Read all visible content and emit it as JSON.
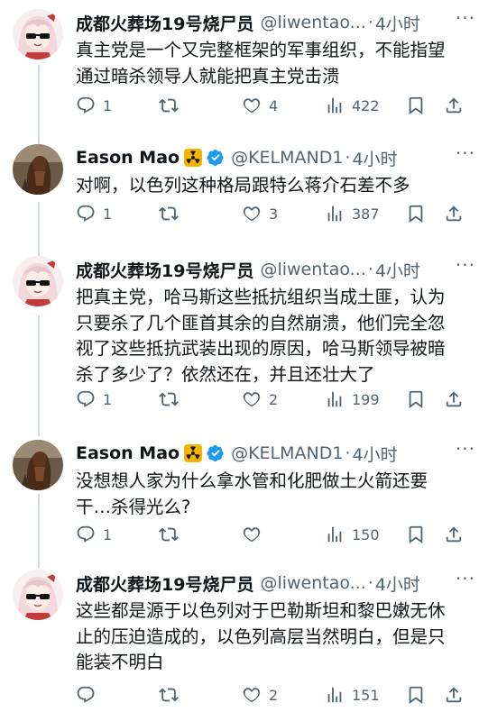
{
  "tweets": [
    {
      "author_name": "成都火葬场19号烧尸员",
      "handle": "@liwentao...",
      "time": "4小时",
      "verified": false,
      "text": "真主党是一个又完整框架的军事组织，不能指望通过暗杀领导人就能把真主党击溃",
      "replies": "1",
      "reposts": "",
      "likes": "4",
      "views": "422"
    },
    {
      "author_name": "Eason Mao",
      "handle": "@KELMAND1",
      "time": "4小时",
      "verified": true,
      "text": "对啊，以色列这种格局跟特么蒋介石差不多",
      "replies": "1",
      "reposts": "",
      "likes": "3",
      "views": "387"
    },
    {
      "author_name": "成都火葬场19号烧尸员",
      "handle": "@liwentao...",
      "time": "4小时",
      "verified": false,
      "text": "把真主党，哈马斯这些抵抗组织当成土匪，认为只要杀了几个匪首其余的自然崩溃，他们完全忽视了这些抵抗武装出现的原因，哈马斯领导被暗杀了多少了？依然还在，并且还壮大了",
      "replies": "1",
      "reposts": "",
      "likes": "2",
      "views": "199"
    },
    {
      "author_name": "Eason Mao",
      "handle": "@KELMAND1",
      "time": "4小时",
      "verified": true,
      "text": "没想想人家为什么拿水管和化肥做土火箭还要干…杀得光么?",
      "replies": "1",
      "reposts": "",
      "likes": "",
      "views": "150"
    },
    {
      "author_name": "成都火葬场19号烧尸员",
      "handle": "@liwentao...",
      "time": "4小时",
      "verified": false,
      "text": "这些都是源于以色列对于巴勒斯坦和黎巴嫩无休止的压迫造成的，以色列高层当然明白，但是只能装不明白",
      "replies": "",
      "reposts": "",
      "likes": "2",
      "views": "151"
    }
  ],
  "ui": {
    "dot": "·",
    "more_glyph": "···"
  },
  "colors": {
    "text": "#0f1419",
    "secondary": "#536471",
    "verified_blue": "#1d9bf0",
    "radiation_badge": "#f5b400",
    "thread_line": "#cfd9de"
  },
  "icons": {
    "reply": "reply-icon",
    "repost": "repost-icon",
    "like": "heart-icon",
    "views": "views-icon",
    "bookmark": "bookmark-icon",
    "share": "share-icon"
  }
}
